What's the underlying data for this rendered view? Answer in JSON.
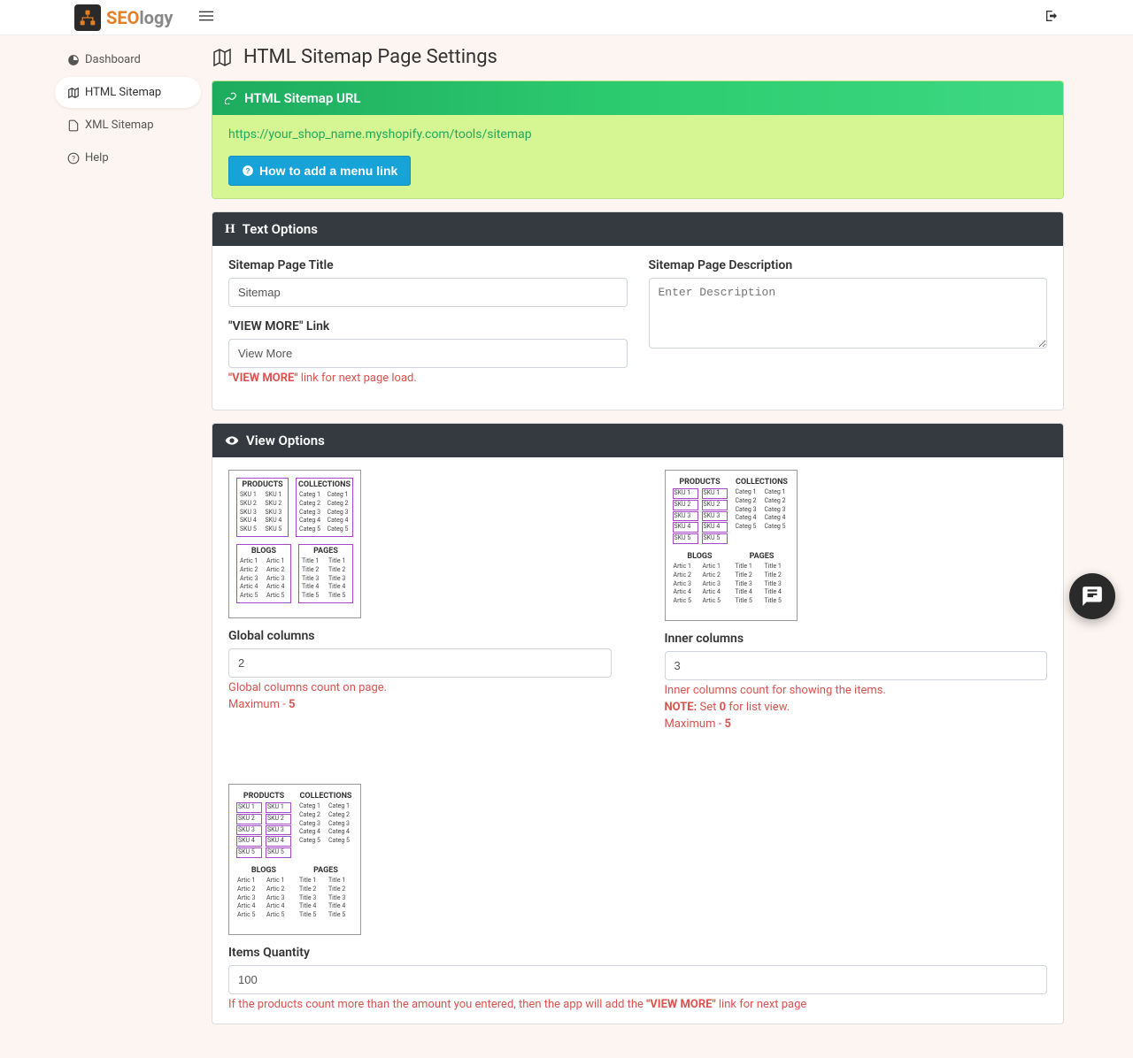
{
  "brand": {
    "seo": "SEO",
    "logy": "logy"
  },
  "sidebar": {
    "items": [
      {
        "label": "Dashboard"
      },
      {
        "label": "HTML Sitemap"
      },
      {
        "label": "XML Sitemap"
      },
      {
        "label": "Help"
      }
    ]
  },
  "page": {
    "title": "HTML Sitemap Page Settings"
  },
  "url_card": {
    "header": "HTML Sitemap URL",
    "url": "https://your_shop_name.myshopify.com/tools/sitemap",
    "button": "How to add a menu link"
  },
  "text_options": {
    "header": "Text Options",
    "title_label": "Sitemap Page Title",
    "title_value": "Sitemap",
    "desc_label": "Sitemap Page Description",
    "desc_placeholder": "Enter Description",
    "viewmore_label": "\"VIEW MORE\" Link",
    "viewmore_value": "View More",
    "viewmore_hint_strong": "\"VIEW MORE\"",
    "viewmore_hint_rest": " link for next page load."
  },
  "view_options": {
    "header": "View Options",
    "global": {
      "label": "Global columns",
      "value": "2",
      "hint1": "Global columns count on page.",
      "hint2_pre": "Maximum - ",
      "hint2_val": "5"
    },
    "inner": {
      "label": "Inner columns",
      "value": "3",
      "hint1": "Inner columns count for showing the items.",
      "hint2_strong": "NOTE:",
      "hint2_mid": " Set ",
      "hint2_val": "0",
      "hint2_rest": " for list view.",
      "hint3_pre": "Maximum - ",
      "hint3_val": "5"
    },
    "items": {
      "label": "Items Quantity",
      "value": "100",
      "hint_pre": "If the products count more than the amount you entered, then the app will add the ",
      "hint_strong": "\"VIEW MORE\"",
      "hint_post": " link for next page"
    },
    "diagram": {
      "sections": [
        "PRODUCTS",
        "COLLECTIONS",
        "BLOGS",
        "PAGES"
      ],
      "skus": [
        "SKU 1",
        "SKU 2",
        "SKU 3",
        "SKU 4",
        "SKU 5"
      ],
      "categs": [
        "Categ 1",
        "Categ 2",
        "Categ 3",
        "Categ 4",
        "Categ 5"
      ],
      "artics": [
        "Artic 1",
        "Artic 2",
        "Artic 3",
        "Artic 4",
        "Artic 5"
      ],
      "titles": [
        "Title 1",
        "Title 2",
        "Title 3",
        "Title 4",
        "Title 5"
      ]
    }
  }
}
